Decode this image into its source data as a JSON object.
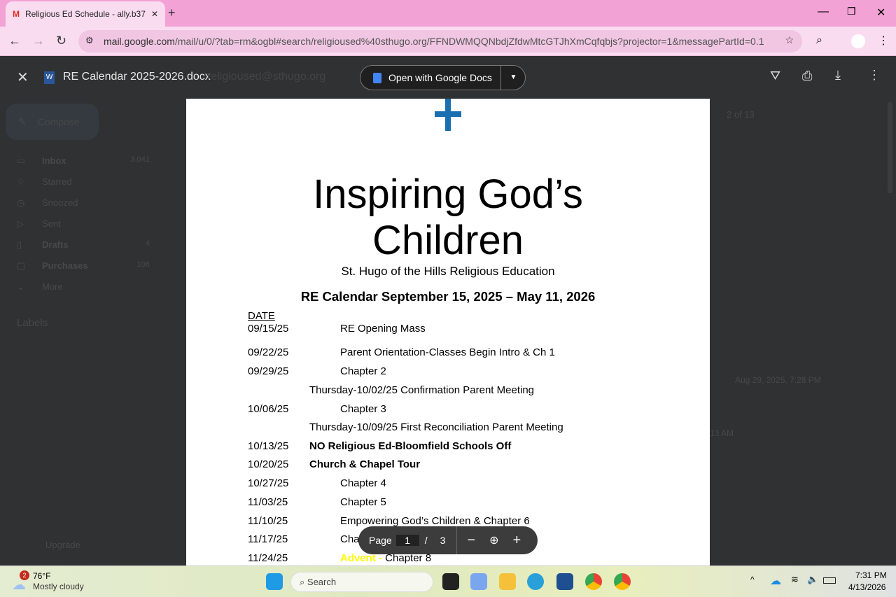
{
  "browser": {
    "tab_title": "Religious Ed Schedule - ally.b37",
    "url_host": "mail.google.com",
    "url_path": "/mail/u/0/?tab=rm&ogbl#search/religioused%40sthugo.org/FFNDWMQQNbdjZfdwMtcGTJhXmCqfqbjs?projector=1&messagePartId=0.1",
    "new_tab": "+",
    "close_tab": "✕"
  },
  "viewer": {
    "file_name": "RE Calendar 2025-2026.docx",
    "sender": "religioused@sthugo.org",
    "open_with": "Open with Google Docs"
  },
  "gmail": {
    "compose": "Compose",
    "sidebar": [
      {
        "label": "Inbox",
        "count": "3,041",
        "bold": true
      },
      {
        "label": "Starred",
        "count": ""
      },
      {
        "label": "Snoozed",
        "count": ""
      },
      {
        "label": "Sent",
        "count": ""
      },
      {
        "label": "Drafts",
        "count": "4",
        "bold": true
      },
      {
        "label": "Purchases",
        "count": "106",
        "bold": true
      },
      {
        "label": "More",
        "count": ""
      }
    ],
    "labels": "Labels",
    "upgrade": "Upgrade",
    "pagination": "2 of 13",
    "date1": "Aug 29, 2025, 7:28 PM",
    "date2": "13 AM"
  },
  "document": {
    "title_line1": "Inspiring God’s",
    "title_line2": "Children",
    "subtitle": "St. Hugo of the Hills Religious Education",
    "heading": "RE Calendar September 15, 2025 – May 11, 2026",
    "date_header": "DATE",
    "rows": [
      {
        "date": "09/15/25",
        "text": "RE Opening Mass"
      },
      {
        "date": "09/22/25",
        "text": "Parent Orientation-Classes Begin Intro & Ch 1"
      },
      {
        "date": "09/29/25",
        "text": "Chapter 2"
      },
      {
        "date": "",
        "text": "Thursday-10/02/25 Confirmation Parent Meeting"
      },
      {
        "date": "10/06/25",
        "text": "Chapter 3"
      },
      {
        "date": "",
        "text": "Thursday-10/09/25 First Reconciliation Parent Meeting"
      },
      {
        "date": "10/13/25",
        "text": "NO Religious Ed-Bloomfield Schools Off"
      },
      {
        "date": "10/20/25",
        "text": "Church & Chapel Tour"
      },
      {
        "date": "10/27/25",
        "text": "Chapter 4"
      },
      {
        "date": "11/03/25",
        "text": "Chapter 5"
      },
      {
        "date": "11/10/25",
        "text": "Empowering God’s Children & Chapter 6"
      },
      {
        "date": "11/17/25",
        "text": "Chapter 7"
      },
      {
        "date": "11/24/25",
        "highlight": "Advent - ",
        "text": "Chapter 8"
      }
    ],
    "highlight_color": "#ffff00",
    "logo_color": "#1a6fb0"
  },
  "pager": {
    "label": "Page",
    "current": "1",
    "sep": "/",
    "total": "3"
  },
  "taskbar": {
    "weather_temp": "76°F",
    "weather_desc": "Mostly cloudy",
    "weather_badge": "2",
    "search": "Search",
    "time": "7:31 PM",
    "date": "4/13/2026"
  }
}
